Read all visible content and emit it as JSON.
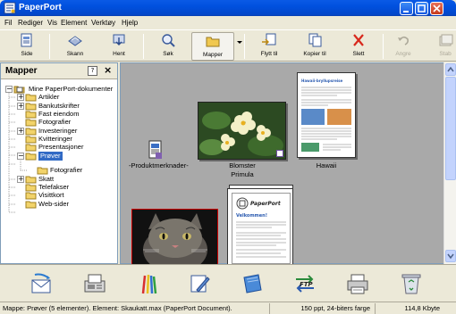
{
  "window": {
    "title": "PaperPort"
  },
  "menu": [
    "Fil",
    "Rediger",
    "Vis",
    "Element",
    "Verktøy",
    "Hjelp"
  ],
  "toolbar": {
    "buttons": [
      {
        "label": "Side",
        "icon": "page-icon"
      },
      {
        "label": "Skann",
        "icon": "scanner-icon"
      },
      {
        "label": "Hent",
        "icon": "get-icon"
      },
      {
        "label": "Søk",
        "icon": "search-icon"
      },
      {
        "label": "Mapper",
        "icon": "folders-icon"
      },
      {
        "label": "Flytt til",
        "icon": "move-to-icon"
      },
      {
        "label": "Kopier til",
        "icon": "copy-to-icon"
      },
      {
        "label": "Slett",
        "icon": "delete-icon"
      },
      {
        "label": "Angre",
        "icon": "undo-icon"
      },
      {
        "label": "Stab",
        "icon": "stack-icon"
      }
    ]
  },
  "panel": {
    "title": "Mapper",
    "help": "?",
    "close": "×",
    "tree": [
      {
        "label": "Mine PaperPort-dokumenter",
        "expander": "−"
      },
      {
        "label": "Artikler",
        "expander": "+"
      },
      {
        "label": "Bankutskrifter",
        "expander": "+"
      },
      {
        "label": "Fast eiendom",
        "expander": ""
      },
      {
        "label": "Fotografier",
        "expander": ""
      },
      {
        "label": "Investeringer",
        "expander": "+"
      },
      {
        "label": "Kvitteringer",
        "expander": ""
      },
      {
        "label": "Presentasjoner",
        "expander": ""
      },
      {
        "label": "Prøver",
        "expander": "−"
      },
      {
        "label": "Fotografier",
        "expander": ""
      },
      {
        "label": "Skatt",
        "expander": "+"
      },
      {
        "label": "Telefakser",
        "expander": ""
      },
      {
        "label": "Visittkort",
        "expander": ""
      },
      {
        "label": "Web-sider",
        "expander": ""
      }
    ]
  },
  "documents": [
    {
      "label": "-Produktmerknader-"
    },
    {
      "label": "Blomster",
      "label2": "Primula"
    },
    {
      "label": "Hawaii",
      "heading": "Hawaii-bryllupsreise"
    },
    {
      "label": "",
      "heading": "Velkommen!",
      "logo": "PaperPort"
    },
    {
      "label": ""
    }
  ],
  "sendto": [
    "email-icon",
    "fax-icon",
    "pencils-icon",
    "draw-icon",
    "pad-icon",
    "ftp-icon",
    "printer-icon",
    "recycle-icon"
  ],
  "sendto_text": {
    "ftp": "FTP"
  },
  "status": {
    "folder": "Mappe: Prøver (5 elementer). Element: Skaukatt.max (PaperPort Document).",
    "resolution": "150 ppt, 24-biters farge",
    "size": "114,8 Kbyte"
  }
}
